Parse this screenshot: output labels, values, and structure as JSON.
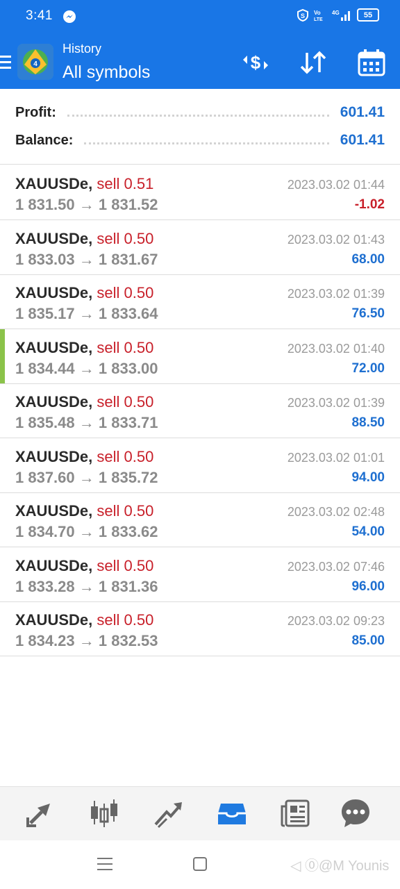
{
  "status_bar": {
    "time": "3:41",
    "battery": "55"
  },
  "app_bar": {
    "subtitle": "History",
    "title": "All symbols"
  },
  "summary": {
    "profit_label": "Profit:",
    "profit_value": "601.41",
    "balance_label": "Balance:",
    "balance_value": "601.41"
  },
  "deals": [
    {
      "symbol": "XAUUSDe,",
      "side": "sell 0.51",
      "open": "1 831.50",
      "close": "1 831.52",
      "time": "2023.03.02 01:44",
      "profit": "-1.02",
      "negative": true,
      "selected": false
    },
    {
      "symbol": "XAUUSDe,",
      "side": "sell 0.50",
      "open": "1 833.03",
      "close": "1 831.67",
      "time": "2023.03.02 01:43",
      "profit": "68.00",
      "negative": false,
      "selected": false
    },
    {
      "symbol": "XAUUSDe,",
      "side": "sell 0.50",
      "open": "1 835.17",
      "close": "1 833.64",
      "time": "2023.03.02 01:39",
      "profit": "76.50",
      "negative": false,
      "selected": false
    },
    {
      "symbol": "XAUUSDe,",
      "side": "sell 0.50",
      "open": "1 834.44",
      "close": "1 833.00",
      "time": "2023.03.02 01:40",
      "profit": "72.00",
      "negative": false,
      "selected": true
    },
    {
      "symbol": "XAUUSDe,",
      "side": "sell 0.50",
      "open": "1 835.48",
      "close": "1 833.71",
      "time": "2023.03.02 01:39",
      "profit": "88.50",
      "negative": false,
      "selected": false
    },
    {
      "symbol": "XAUUSDe,",
      "side": "sell 0.50",
      "open": "1 837.60",
      "close": "1 835.72",
      "time": "2023.03.02 01:01",
      "profit": "94.00",
      "negative": false,
      "selected": false
    },
    {
      "symbol": "XAUUSDe,",
      "side": "sell 0.50",
      "open": "1 834.70",
      "close": "1 833.62",
      "time": "2023.03.02 02:48",
      "profit": "54.00",
      "negative": false,
      "selected": false
    },
    {
      "symbol": "XAUUSDe,",
      "side": "sell 0.50",
      "open": "1 833.28",
      "close": "1 831.36",
      "time": "2023.03.02 07:46",
      "profit": "96.00",
      "negative": false,
      "selected": false
    },
    {
      "symbol": "XAUUSDe,",
      "side": "sell 0.50",
      "open": "1 834.23",
      "close": "1 832.53",
      "time": "2023.03.02 09:23",
      "profit": "85.00",
      "negative": false,
      "selected": false
    }
  ],
  "arrow": "→",
  "colors": {
    "accent": "#1976e6",
    "profit_positive": "#1e6fd0",
    "profit_negative": "#c8202a",
    "sell": "#c8202a",
    "selection_marker": "#8bc34a"
  },
  "icons": {
    "toolbar": [
      "currency-exchange-icon",
      "sort-icon",
      "calendar-icon"
    ],
    "bottom_nav": [
      "quotes-icon",
      "chart-icon",
      "trade-icon",
      "history-icon",
      "news-icon",
      "chat-icon"
    ]
  },
  "watermark": "◁ ⓪@M Younis"
}
